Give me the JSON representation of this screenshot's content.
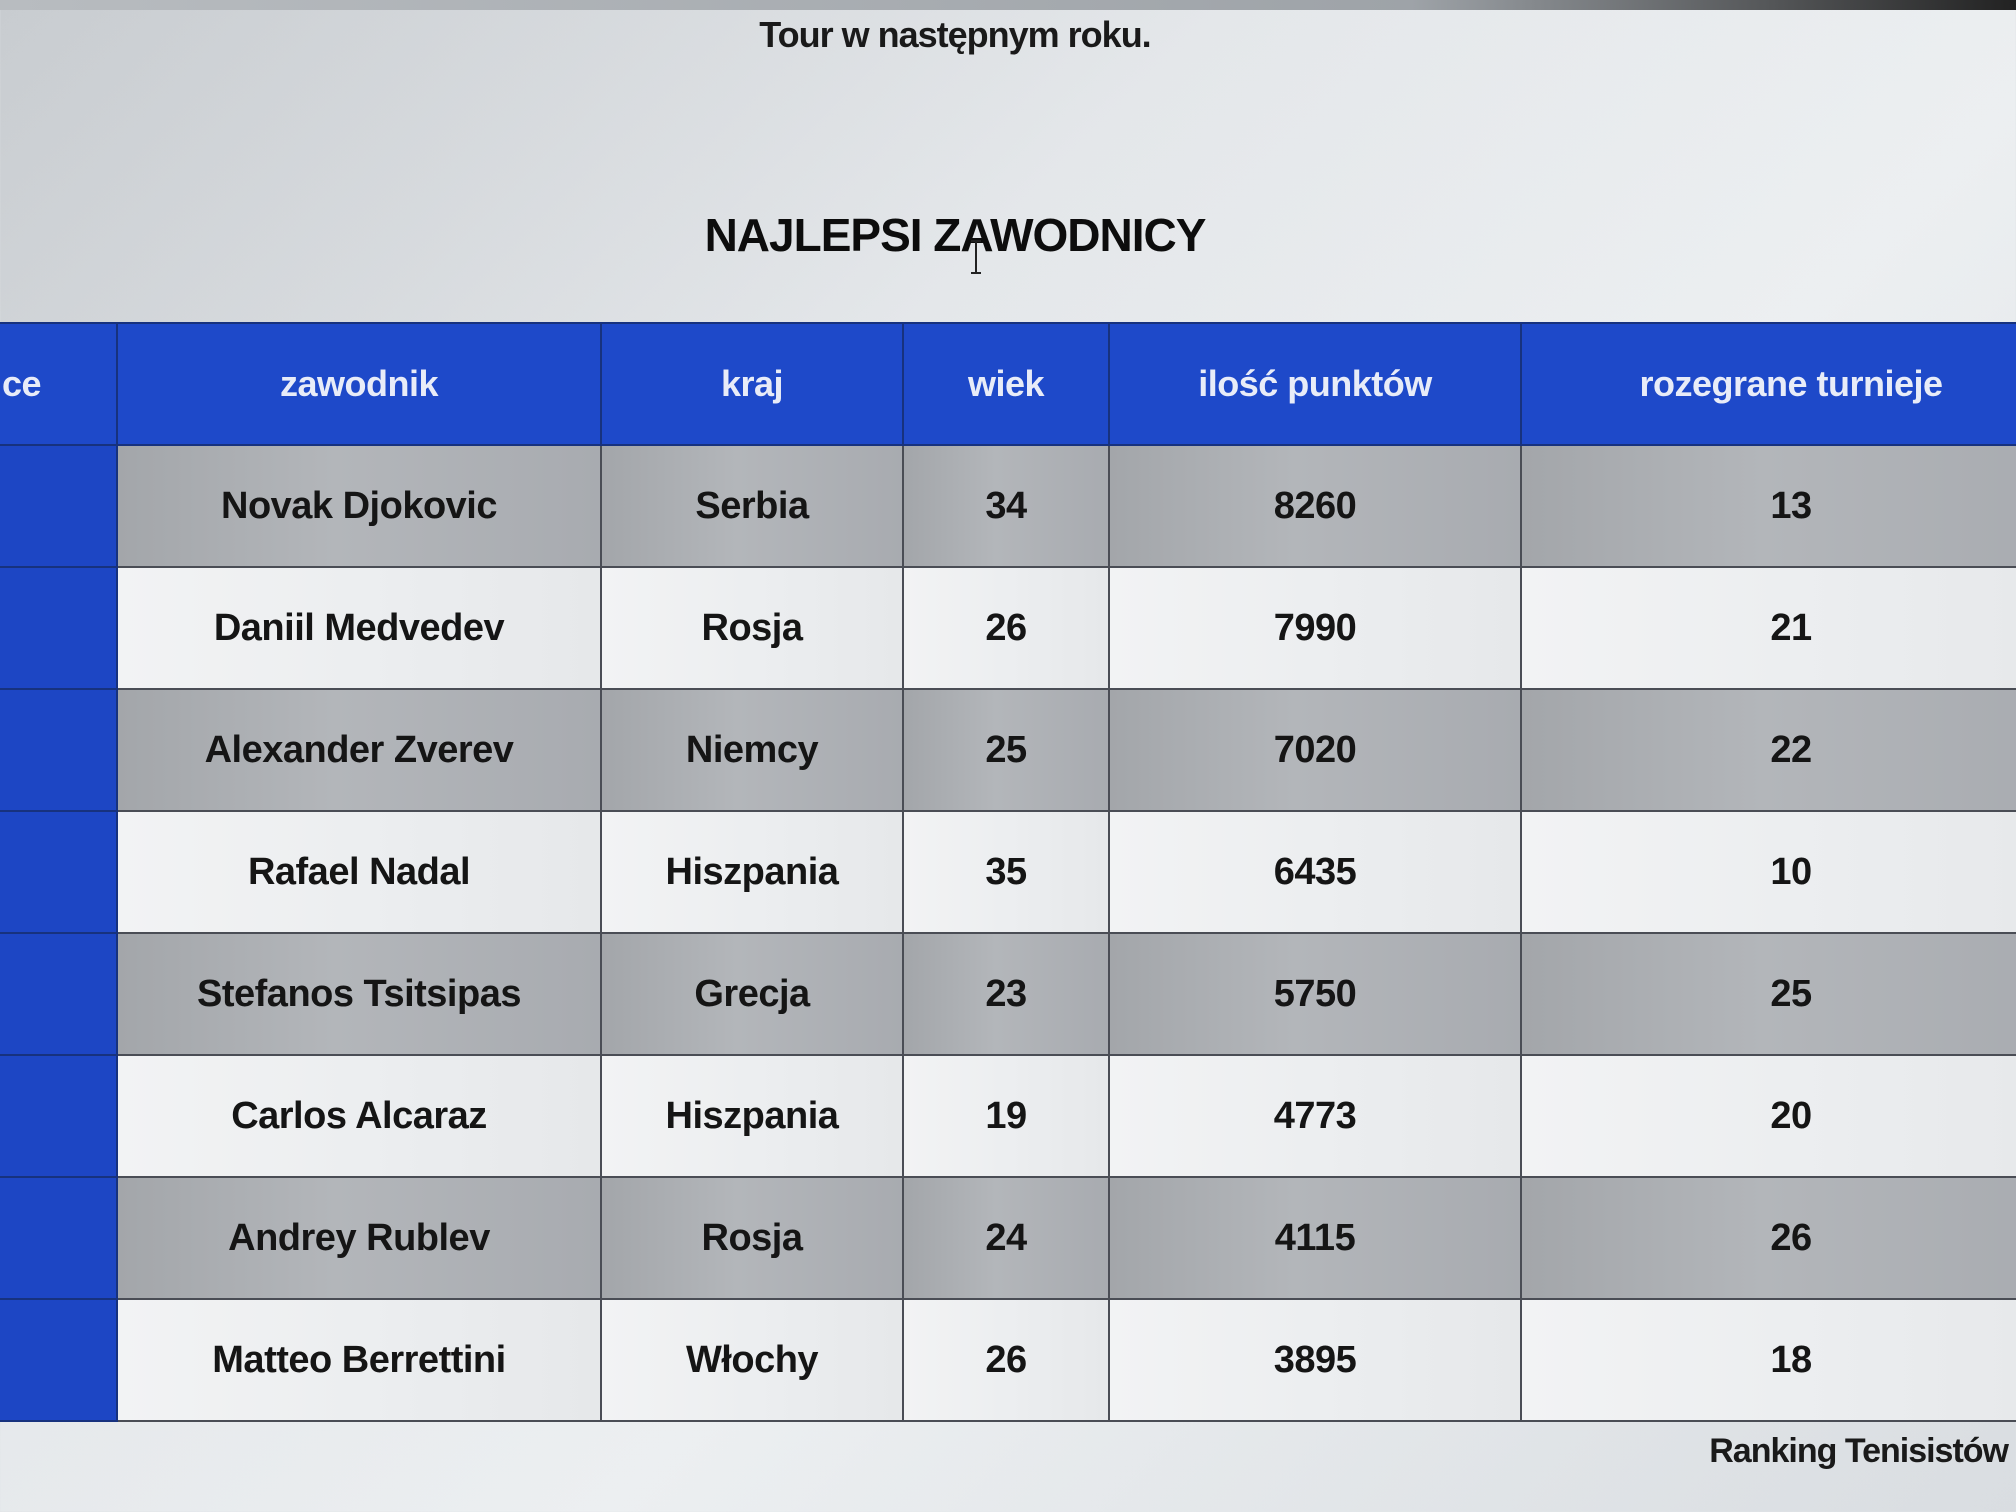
{
  "page": {
    "intro_text": "Tour w następnym roku.",
    "title": "NAJLEPSI ZAWODNICY",
    "footer_caption": "Ranking Tenisistów"
  },
  "table": {
    "headers": {
      "place": "ce",
      "player": "zawodnik",
      "country": "kraj",
      "age": "wiek",
      "points": "ilość punktów",
      "tournaments": "rozegrane turnieje"
    },
    "rows": [
      {
        "player": "Novak Djokovic",
        "country": "Serbia",
        "age": "34",
        "points": "8260",
        "tournaments": "13"
      },
      {
        "player": "Daniil Medvedev",
        "country": "Rosja",
        "age": "26",
        "points": "7990",
        "tournaments": "21"
      },
      {
        "player": "Alexander Zverev",
        "country": "Niemcy",
        "age": "25",
        "points": "7020",
        "tournaments": "22"
      },
      {
        "player": "Rafael Nadal",
        "country": "Hiszpania",
        "age": "35",
        "points": "6435",
        "tournaments": "10"
      },
      {
        "player": "Stefanos Tsitsipas",
        "country": "Grecja",
        "age": "23",
        "points": "5750",
        "tournaments": "25"
      },
      {
        "player": "Carlos Alcaraz",
        "country": "Hiszpania",
        "age": "19",
        "points": "4773",
        "tournaments": "20"
      },
      {
        "player": "Andrey Rublev",
        "country": "Rosja",
        "age": "24",
        "points": "4115",
        "tournaments": "26"
      },
      {
        "player": "Matteo Berrettini",
        "country": "Włochy",
        "age": "26",
        "points": "3895",
        "tournaments": "18"
      }
    ]
  },
  "colors": {
    "header_blue": "#1e49c9",
    "row_dark": "#a8abb0",
    "row_light": "#eceef0"
  },
  "icons": {
    "cursor": "text-cursor-icon"
  }
}
